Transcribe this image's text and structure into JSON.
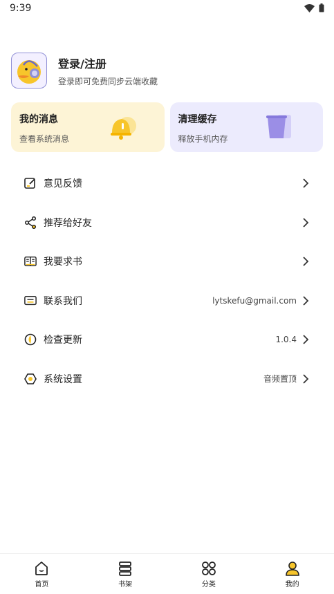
{
  "status": {
    "time": "9:39"
  },
  "profile": {
    "title": "登录/注册",
    "subtitle": "登录即可免费同步云端收藏"
  },
  "cards": [
    {
      "title": "我的消息",
      "subtitle": "查看系统消息"
    },
    {
      "title": "清理缓存",
      "subtitle": "释放手机内存"
    }
  ],
  "menu": [
    {
      "label": "意见反馈",
      "value": ""
    },
    {
      "label": "推荐给好友",
      "value": ""
    },
    {
      "label": "我要求书",
      "value": ""
    },
    {
      "label": "联系我们",
      "value": "lytskefu@gmail.com"
    },
    {
      "label": "检查更新",
      "value": "1.0.4"
    },
    {
      "label": "系统设置",
      "value": "音频置顶"
    }
  ],
  "tabs": [
    {
      "label": "首页"
    },
    {
      "label": "书架"
    },
    {
      "label": "分类"
    },
    {
      "label": "我的"
    }
  ],
  "colors": {
    "accent_yellow": "#f7c52b",
    "msg_card": "#fdf4d6",
    "cache_card": "#ecebfd",
    "cache_icon": "#9b8ee6"
  }
}
